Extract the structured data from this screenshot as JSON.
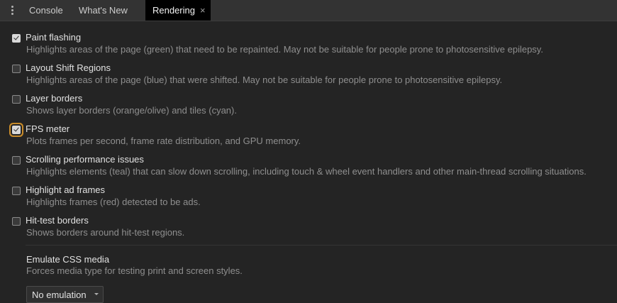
{
  "tabs": [
    {
      "label": "Console"
    },
    {
      "label": "What's New"
    },
    {
      "label": "Rendering",
      "active": true,
      "close_glyph": "×"
    }
  ],
  "options": [
    {
      "title": "Paint flashing",
      "description": "Highlights areas of the page (green) that need to be repainted. May not be suitable for people prone to photosensitive epilepsy.",
      "checked": true
    },
    {
      "title": "Layout Shift Regions",
      "description": "Highlights areas of the page (blue) that were shifted. May not be suitable for people prone to photosensitive epilepsy.",
      "checked": false
    },
    {
      "title": "Layer borders",
      "description": "Shows layer borders (orange/olive) and tiles (cyan).",
      "checked": false
    },
    {
      "title": "FPS meter",
      "description": "Plots frames per second, frame rate distribution, and GPU memory.",
      "checked": true,
      "focused": true
    },
    {
      "title": "Scrolling performance issues",
      "description": "Highlights elements (teal) that can slow down scrolling, including touch & wheel event handlers and other main-thread scrolling situations.",
      "checked": false
    },
    {
      "title": "Highlight ad frames",
      "description": "Highlights frames (red) detected to be ads.",
      "checked": false
    },
    {
      "title": "Hit-test borders",
      "description": "Shows borders around hit-test regions.",
      "checked": false
    }
  ],
  "emulate_media": {
    "title": "Emulate CSS media",
    "description": "Forces media type for testing print and screen styles.",
    "selected": "No emulation"
  },
  "colors": {
    "background": "#242424",
    "tabbar": "#333333",
    "active_tab": "#000000",
    "focus_ring": "#c68a2a"
  }
}
